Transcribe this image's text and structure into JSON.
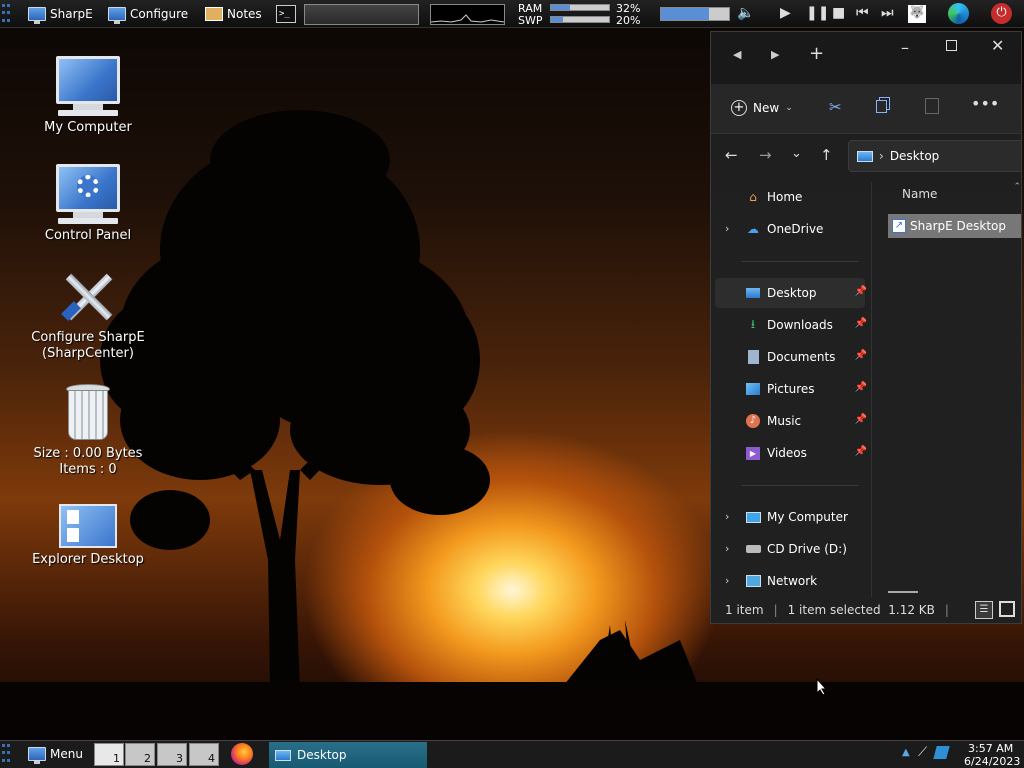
{
  "topbar": {
    "items": [
      {
        "label": "SharpE",
        "icon": "monitor-icon"
      },
      {
        "label": "Configure",
        "icon": "monitor-icon"
      },
      {
        "label": "Notes",
        "icon": "notes-icon"
      }
    ],
    "ram_label": "RAM",
    "swp_label": "SWP",
    "ram_percent": "32%",
    "swp_percent": "20%",
    "ram_value": 0.32,
    "swp_value": 0.2,
    "volume_value": 0.7
  },
  "desktop_icons": [
    {
      "label": "My Computer",
      "icon": "computer-icon"
    },
    {
      "label": "Control Panel",
      "icon": "control-panel-icon"
    },
    {
      "label": "Configure SharpE\n(SharpCenter)",
      "line1": "Configure SharpE",
      "line2": "(SharpCenter)",
      "icon": "tools-icon"
    },
    {
      "line1": "Size : 0.00 Bytes",
      "line2": "Items : 0",
      "icon": "recycle-bin-icon"
    },
    {
      "label": "Explorer Desktop",
      "icon": "explorer-desktop-icon"
    }
  ],
  "explorer": {
    "new_label": "New",
    "address": "Desktop",
    "column_name": "Name",
    "nav": {
      "home": "Home",
      "onedrive": "OneDrive",
      "desktop": "Desktop",
      "downloads": "Downloads",
      "documents": "Documents",
      "pictures": "Pictures",
      "music": "Music",
      "videos": "Videos",
      "my_computer": "My Computer",
      "cd_drive": "CD Drive (D:)",
      "network": "Network"
    },
    "files": [
      "SharpE Desktop"
    ],
    "status_items": "1 item",
    "status_selected": "1 item selected  1.12 KB"
  },
  "taskbar": {
    "menu_label": "Menu",
    "workspaces": [
      "1",
      "2",
      "3",
      "4"
    ],
    "task_label": "Desktop",
    "time": "3:57 AM",
    "date": "6/24/2023"
  },
  "colors": {
    "accent": "#2d66b8",
    "task_active": "#1f6a85",
    "window_bg": "#202020"
  }
}
